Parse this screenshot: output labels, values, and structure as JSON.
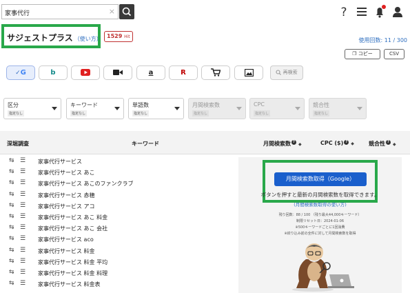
{
  "search": {
    "value": "家事代行",
    "clear_glyph": "×"
  },
  "header_icons": [
    "help-icon",
    "menu-icon",
    "bell-icon",
    "user-icon"
  ],
  "title": {
    "text": "サジェストプラス",
    "howto": "（使い方）"
  },
  "result_count": {
    "number": "1529",
    "unit": "Hit"
  },
  "usage": {
    "label": "使用回数:",
    "used": "11",
    "total": "300",
    "text": "使用回数: 11 / 300"
  },
  "buttons": {
    "copy": "コピー",
    "csv": "CSV",
    "research": "再検索"
  },
  "engines": [
    {
      "name": "google",
      "glyph": "G",
      "active": true
    },
    {
      "name": "bing",
      "glyph": "b",
      "active": false
    },
    {
      "name": "youtube",
      "glyph": "▶",
      "active": false
    },
    {
      "name": "video",
      "glyph": "■",
      "active": false
    },
    {
      "name": "amazon",
      "glyph": "a",
      "active": false
    },
    {
      "name": "rakuten",
      "glyph": "R",
      "active": false
    },
    {
      "name": "shopping",
      "glyph": "🛒",
      "active": false
    },
    {
      "name": "image",
      "glyph": "▣",
      "active": false
    }
  ],
  "filters": [
    {
      "label": "区分",
      "sub": "指定なし",
      "enabled": true
    },
    {
      "label": "キーワード",
      "sub": "指定なし",
      "enabled": true
    },
    {
      "label": "単語数",
      "sub": "指定なし",
      "enabled": true
    },
    {
      "label": "月間検索数",
      "sub": "指定なし",
      "enabled": false
    },
    {
      "label": "CPC",
      "sub": "指定なし",
      "enabled": false
    },
    {
      "label": "競合性",
      "sub": "指定なし",
      "enabled": false
    }
  ],
  "table": {
    "headers": {
      "deep": "深堀調査",
      "keyword": "キーワード",
      "volume": "月間検索数",
      "cpc": "CPC ($)",
      "competition": "競合性"
    },
    "rows": [
      "家事代行サービス",
      "家事代行サービス あこ",
      "家事代行サービス あこのファンクラブ",
      "家事代行サービス 赤穂",
      "家事代行サービス アコ",
      "家事代行サービス あこ 料金",
      "家事代行サービス あこ 会社",
      "家事代行サービス aco",
      "家事代行サービス 料金",
      "家事代行サービス 料金 平均",
      "家事代行サービス 料金 料理",
      "家事代行サービス 料金表"
    ]
  },
  "panel": {
    "button": "月間検索数取得（Google）",
    "message": "ボタンを押すと最新の月間検索数を取得できます。",
    "link": "(月間検索数取得の使い方)",
    "notes": [
      "残り回数：88 / 100 （残り最大44,000キーワード）",
      "制限リセット日：2024-01-06",
      "※500キーワードごとに1回消費",
      "※絞り込み前の全件に対して月間検索数を取得"
    ]
  },
  "colors": {
    "accent_green": "#29a84a",
    "primary_blue": "#1a5fcc",
    "badge_red": "#c03030"
  }
}
